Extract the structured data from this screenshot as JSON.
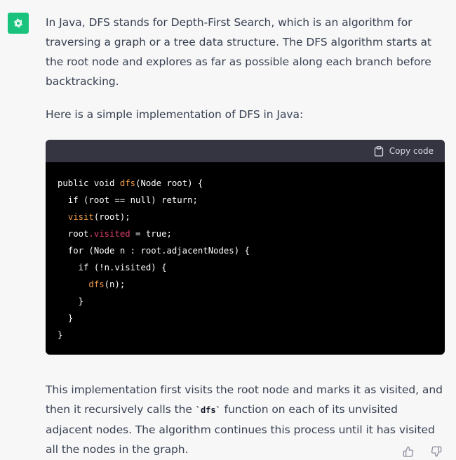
{
  "assistant": {
    "brand_color": "#19c37d",
    "icon": "openai-logo-icon"
  },
  "message": {
    "paragraph1": "In Java, DFS stands for Depth-First Search, which is an algorithm for traversing a graph or a tree data structure. The DFS algorithm starts at the root node and explores as far as possible along each branch before backtracking.",
    "paragraph2": "Here is a simple implementation of DFS in Java:",
    "paragraph3_before": "This implementation first visits the root node and marks it as visited, and then it recursively calls the ",
    "paragraph3_code": "`dfs`",
    "paragraph3_after": " function on each of its unvisited adjacent nodes. The algorithm continues this process until it has visited all the nodes in the graph."
  },
  "code_block": {
    "copy_label": "Copy code",
    "copy_icon": "clipboard-icon",
    "lines": [
      [
        {
          "t": "public void "
        },
        {
          "t": "dfs",
          "c": "fn"
        },
        {
          "t": "(Node root) {"
        }
      ],
      [
        {
          "t": "  if (root == null) return;"
        }
      ],
      [
        {
          "t": "  "
        },
        {
          "t": "visit",
          "c": "fn"
        },
        {
          "t": "(root);"
        }
      ],
      [
        {
          "t": "  root"
        },
        {
          "t": ".visited",
          "c": "kw-red"
        },
        {
          "t": " = true;"
        }
      ],
      [
        {
          "t": "  for (Node n : root.adjacentNodes) {"
        }
      ],
      [
        {
          "t": "    if (!n.visited) {"
        }
      ],
      [
        {
          "t": "      "
        },
        {
          "t": "dfs",
          "c": "fn"
        },
        {
          "t": "(n);"
        }
      ],
      [
        {
          "t": "    }"
        }
      ],
      [
        {
          "t": "  }"
        }
      ],
      [
        {
          "t": "}"
        }
      ]
    ]
  },
  "feedback": {
    "thumbs_up_icon": "thumbs-up-icon",
    "thumbs_down_icon": "thumbs-down-icon"
  }
}
